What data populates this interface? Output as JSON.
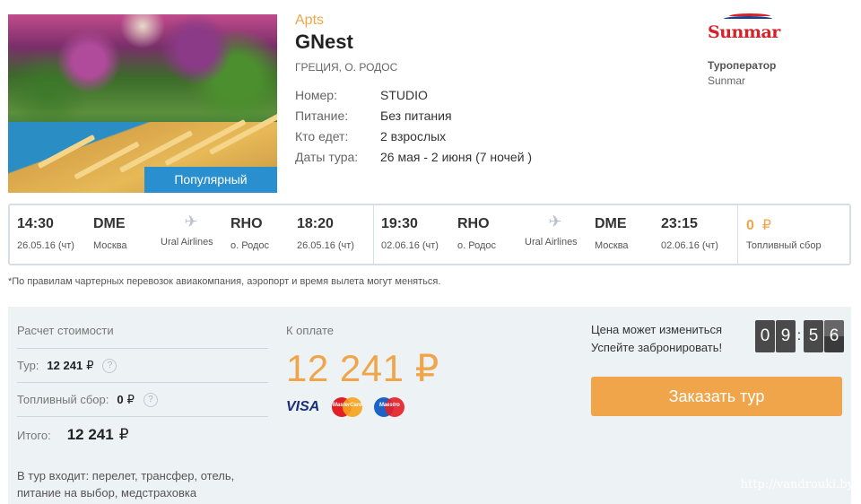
{
  "hotel": {
    "category": "Apts",
    "name": "GNest",
    "location": "ГРЕЦИЯ, О. РОДОС",
    "badge": "Популярный",
    "details": [
      {
        "label": "Номер:",
        "value": "STUDIO"
      },
      {
        "label": "Питание:",
        "value": "Без питания"
      },
      {
        "label": "Кто едет:",
        "value": "2 взрослых"
      },
      {
        "label": "Даты тура:",
        "value": "26 мая - 2 июня (7 ночей )"
      }
    ]
  },
  "operator": {
    "logo_text": "Sunmar",
    "label": "Туроператор",
    "name": "Sunmar"
  },
  "flights": {
    "outbound": {
      "dep_time": "14:30",
      "dep_date": "26.05.16 (чт)",
      "dep_code": "DME",
      "dep_city": "Москва",
      "airline": "Ural Airlines",
      "arr_code": "RHO",
      "arr_city": "о. Родос",
      "arr_time": "18:20",
      "arr_date": "26.05.16 (чт)"
    },
    "return": {
      "dep_time": "19:30",
      "dep_date": "02.06.16 (чт)",
      "dep_code": "RHO",
      "dep_city": "о. Родос",
      "airline": "Ural Airlines",
      "arr_code": "DME",
      "arr_city": "Москва",
      "arr_time": "23:15",
      "arr_date": "02.06.16 (чт)"
    },
    "fuel": {
      "amount": "0",
      "currency": "₽",
      "label": "Топливный сбор"
    }
  },
  "note": "*По правилам чартерных перевозок авиакомпания, аэропорт и время вылета могут меняться.",
  "calculation": {
    "title": "Расчет стоимости",
    "tour_label": "Тур:",
    "tour_value": "12 241",
    "currency": "₽",
    "fuel_label": "Топливный сбор:",
    "fuel_value": "0",
    "total_label": "Итого:",
    "total_value": "12 241",
    "help_icon": "?",
    "includes": "В тур входит: перелет, трансфер, отель, питание на выбор, медстраховка"
  },
  "payment": {
    "label": "К оплате",
    "amount": "12 241 ₽",
    "cards": {
      "visa": "VISA",
      "mastercard": "MasterCard",
      "maestro": "Maestro"
    }
  },
  "booking": {
    "warn_line1": "Цена может измениться",
    "warn_line2": "Успейте забронировать!",
    "timer": [
      "0",
      "9",
      "5",
      "6"
    ],
    "button": "Заказать тур"
  },
  "watermark": "http://vandrouki.by",
  "colors": {
    "accent": "#f0a54a",
    "badge": "#2a8fcf",
    "panel": "#edf2f5"
  }
}
